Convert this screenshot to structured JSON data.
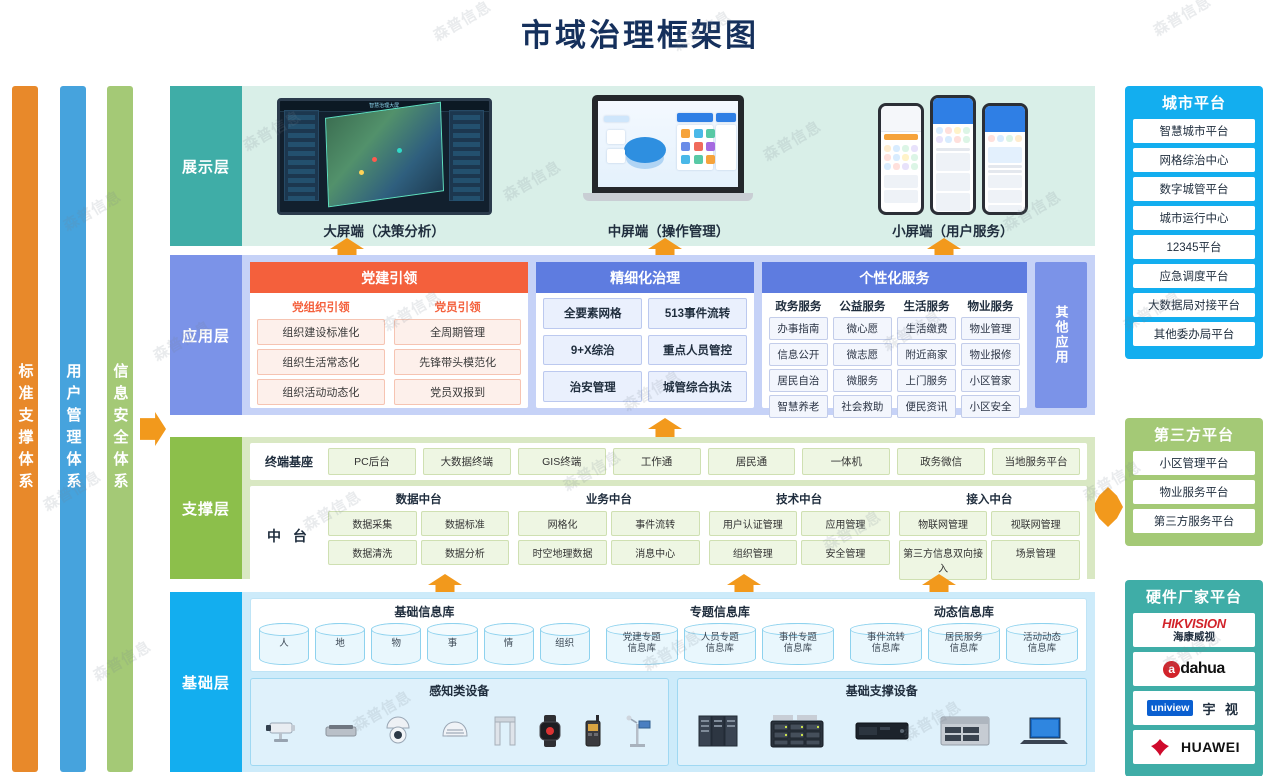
{
  "title": "市域治理框架图",
  "watermark": "森普信息",
  "side_systems": [
    {
      "label": "标准支撑体系",
      "color": "#e8892a"
    },
    {
      "label": "用户管理体系",
      "color": "#46a3dd"
    },
    {
      "label": "信息安全体系",
      "color": "#a4c976"
    }
  ],
  "layers": {
    "presentation": {
      "label": "展示层",
      "color": "#3fada7",
      "screens": [
        {
          "caption": "大屏端（决策分析）",
          "kind": "big-screen"
        },
        {
          "caption": "中屏端（操作管理）",
          "kind": "laptop"
        },
        {
          "caption": "小屏端（用户服务）",
          "kind": "phones"
        }
      ]
    },
    "application": {
      "label": "应用层",
      "color": "#7b93e8",
      "panels": [
        {
          "title": "党建引领",
          "head_color": "#f4603c",
          "columns": [
            {
              "title": "党组织引领",
              "items": [
                "组织建设标准化",
                "组织生活常态化",
                "组织活动动态化"
              ]
            },
            {
              "title": "党员引领",
              "items": [
                "全周期管理",
                "先锋带头模范化",
                "党员双报到"
              ]
            }
          ]
        },
        {
          "title": "精细化治理",
          "head_color": "#5e7ce0",
          "items": [
            "全要素网格",
            "513事件流转",
            "9+X综治",
            "重点人员管控",
            "治安管理",
            "城管综合执法"
          ]
        },
        {
          "title": "个性化服务",
          "head_color": "#5e7ce0",
          "columns": [
            {
              "title": "政务服务",
              "items": [
                "办事指南",
                "信息公开",
                "居民自治",
                "智慧养老"
              ]
            },
            {
              "title": "公益服务",
              "items": [
                "微心愿",
                "微志愿",
                "微服务",
                "社会救助"
              ]
            },
            {
              "title": "生活服务",
              "items": [
                "生活缴费",
                "附近商家",
                "上门服务",
                "便民资讯"
              ]
            },
            {
              "title": "物业服务",
              "items": [
                "物业管理",
                "物业报修",
                "小区管家",
                "小区安全"
              ]
            }
          ]
        }
      ],
      "other_app": "其他应用"
    },
    "support": {
      "label": "支撑层",
      "color": "#8cbf4b",
      "terminal": {
        "label": "终端基座",
        "items": [
          "PC后台",
          "大数据终端",
          "GIS终端",
          "工作通",
          "居民通",
          "一体机",
          "政务微信",
          "当地服务平台"
        ]
      },
      "middle": {
        "label": "中 台",
        "groups": [
          {
            "title": "数据中台",
            "items": [
              "数据采集",
              "数据标准",
              "数据清洗",
              "数据分析"
            ]
          },
          {
            "title": "业务中台",
            "items": [
              "网格化",
              "事件流转",
              "时空地理数据",
              "消息中心"
            ]
          },
          {
            "title": "技术中台",
            "items": [
              "用户认证管理",
              "应用管理",
              "组织管理",
              "安全管理"
            ]
          },
          {
            "title": "接入中台",
            "items": [
              "物联网管理",
              "视联网管理",
              "第三方信息双向接入",
              "场景管理"
            ]
          }
        ]
      }
    },
    "base": {
      "label": "基础层",
      "color": "#13aeef",
      "databases": [
        {
          "title": "基础信息库",
          "items": [
            "人",
            "地",
            "物",
            "事",
            "情",
            "组织"
          ]
        },
        {
          "title": "专题信息库",
          "items": [
            "党建专题\n信息库",
            "人员专题\n信息库",
            "事件专题\n信息库"
          ]
        },
        {
          "title": "动态信息库",
          "items": [
            "事件流转\n信息库",
            "居民服务\n信息库",
            "活动动态\n信息库"
          ]
        }
      ],
      "devices": [
        {
          "title": "感知类设备",
          "icons": [
            "bullet-camera-icon",
            "access-reader-icon",
            "ptz-dome-camera-icon",
            "smoke-detector-icon",
            "security-gate-icon",
            "smart-watch-icon",
            "walkie-talkie-icon",
            "weather-sensor-icon"
          ]
        },
        {
          "title": "基础支撑设备",
          "icons": [
            "server-rack-icon",
            "storage-array-icon",
            "rack-server-icon",
            "network-switch-icon",
            "laptop-icon"
          ]
        }
      ]
    }
  },
  "right_panels": [
    {
      "title": "城市平台",
      "color": "#13aeef",
      "items": [
        "智慧城市平台",
        "网格综治中心",
        "数字城管平台",
        "城市运行中心",
        "12345平台",
        "应急调度平台",
        "大数据局对接平台",
        "其他委办局平台"
      ]
    },
    {
      "title": "第三方平台",
      "color": "#a4c976",
      "items": [
        "小区管理平台",
        "物业服务平台",
        "第三方服务平台"
      ]
    },
    {
      "title": "硬件厂家平台",
      "color": "#3fada7",
      "logos": [
        {
          "name": "hikvision-logo",
          "en": "HIKVISION",
          "cn": "海康威视"
        },
        {
          "name": "dahua-logo",
          "en": "dahua",
          "cn": ""
        },
        {
          "name": "uniview-logo",
          "en": "uniview",
          "cn": "宇 视"
        },
        {
          "name": "huawei-logo",
          "en": "HUAWEI",
          "cn": ""
        }
      ]
    }
  ]
}
